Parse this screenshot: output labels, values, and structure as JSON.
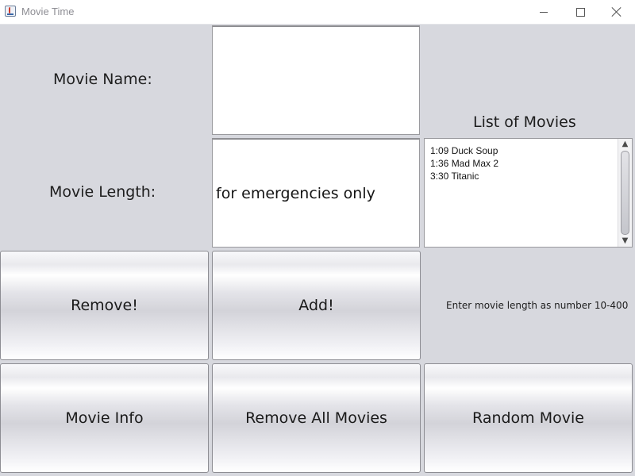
{
  "window": {
    "title": "Movie Time",
    "icon": "java-cup-icon"
  },
  "labels": {
    "movie_name": "Movie Name:",
    "movie_length": "Movie Length:",
    "list_title": "List of Movies",
    "hint": "Enter movie length as number 10-400"
  },
  "inputs": {
    "movie_name_value": "",
    "movie_length_value": "for emergencies only"
  },
  "movies": [
    "1:09 Duck Soup",
    "1:36 Mad Max 2",
    "3:30 Titanic"
  ],
  "buttons": {
    "remove": "Remove!",
    "add": "Add!",
    "info": "Movie Info",
    "remove_all": "Remove All Movies",
    "random": "Random Movie"
  },
  "colors": {
    "background": "#d7d8de",
    "field_background": "#ffffff",
    "title_text": "#8e8e94"
  }
}
